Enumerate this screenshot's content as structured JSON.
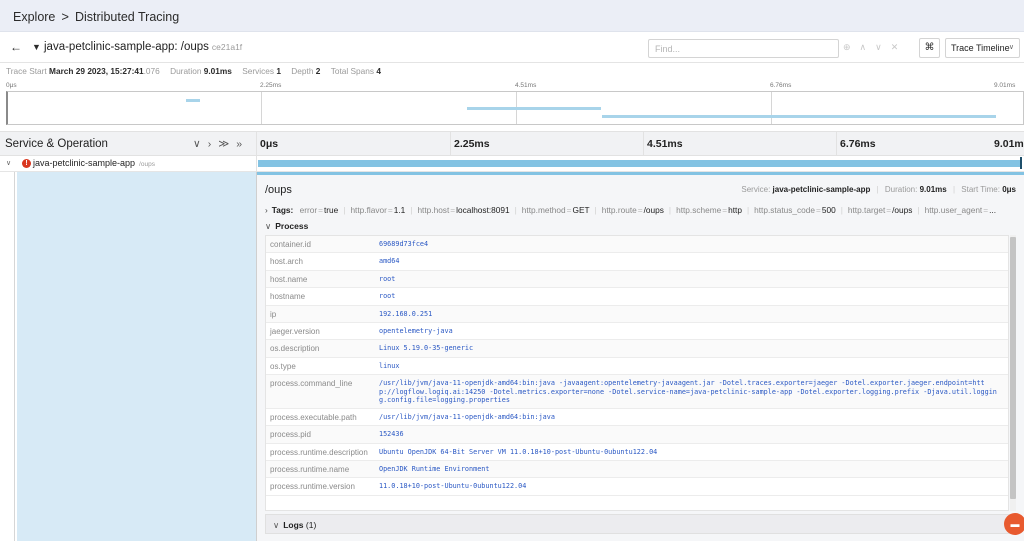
{
  "breadcrumb": {
    "root": "Explore",
    "separator": ">",
    "current": "Distributed Tracing"
  },
  "trace": {
    "title": "java-petclinic-sample-app: /oups",
    "id": "ce21a1f",
    "find_placeholder": "Find...",
    "view_mode": "Trace Timeline"
  },
  "summary": {
    "trace_start_label": "Trace Start",
    "trace_start_value": "March 29 2023, 15:27:41",
    "trace_start_ms": ".076",
    "duration_label": "Duration",
    "duration_value": "9.01ms",
    "services_label": "Services",
    "services_value": "1",
    "depth_label": "Depth",
    "depth_value": "2",
    "total_spans_label": "Total Spans",
    "total_spans_value": "4"
  },
  "minimap": {
    "ticks": [
      "0μs",
      "2.25ms",
      "4.51ms",
      "6.76ms",
      "9.01ms"
    ]
  },
  "timeline": {
    "header_title": "Service & Operation",
    "ticks": [
      "0μs",
      "2.25ms",
      "4.51ms",
      "6.76ms",
      "9.01ms"
    ]
  },
  "span": {
    "service": "java-petclinic-sample-app",
    "operation": "/oups"
  },
  "detail": {
    "operation": "/oups",
    "service_label": "Service:",
    "service_value": "java-petclinic-sample-app",
    "duration_label": "Duration:",
    "duration_value": "9.01ms",
    "start_label": "Start Time:",
    "start_value": "0μs",
    "tags_label": "Tags:",
    "tags": [
      {
        "k": "error",
        "v": "true"
      },
      {
        "k": "http.flavor",
        "v": "1.1"
      },
      {
        "k": "http.host",
        "v": "localhost:8091"
      },
      {
        "k": "http.method",
        "v": "GET"
      },
      {
        "k": "http.route",
        "v": "/oups"
      },
      {
        "k": "http.scheme",
        "v": "http"
      },
      {
        "k": "http.status_code",
        "v": "500"
      },
      {
        "k": "http.target",
        "v": "/oups"
      },
      {
        "k": "http.user_agent",
        "v": "..."
      }
    ],
    "process_label": "Process",
    "process": [
      {
        "k": "container.id",
        "v": "69689d73fce4"
      },
      {
        "k": "host.arch",
        "v": "amd64"
      },
      {
        "k": "host.name",
        "v": "root"
      },
      {
        "k": "hostname",
        "v": "root"
      },
      {
        "k": "ip",
        "v": "192.168.0.251"
      },
      {
        "k": "jaeger.version",
        "v": "opentelemetry-java"
      },
      {
        "k": "os.description",
        "v": "Linux 5.19.0-35-generic"
      },
      {
        "k": "os.type",
        "v": "linux"
      },
      {
        "k": "process.command_line",
        "v": "/usr/lib/jvm/java-11-openjdk-amd64:bin:java -javaagent:opentelemetry-javaagent.jar -Dotel.traces.exporter=jaeger -Dotel.exporter.jaeger.endpoint=http://logflow.logiq.ai:14250 -Dotel.metrics.exporter=none -Dotel.service-name=java-petclinic-sample-app -Dotel.exporter.logging.prefix -Djava.util.logging.config.file=logging.properties"
      },
      {
        "k": "process.executable.path",
        "v": "/usr/lib/jvm/java-11-openjdk-amd64:bin:java"
      },
      {
        "k": "process.pid",
        "v": "152436"
      },
      {
        "k": "process.runtime.description",
        "v": "Ubuntu OpenJDK 64-Bit Server VM 11.0.18+10-post-Ubuntu-0ubuntu122.04"
      },
      {
        "k": "process.runtime.name",
        "v": "OpenJDK Runtime Environment"
      },
      {
        "k": "process.runtime.version",
        "v": "11.0.18+10-post-Ubuntu-0ubuntu122.04"
      }
    ],
    "logs_label": "Logs",
    "logs_count": "(1)"
  }
}
